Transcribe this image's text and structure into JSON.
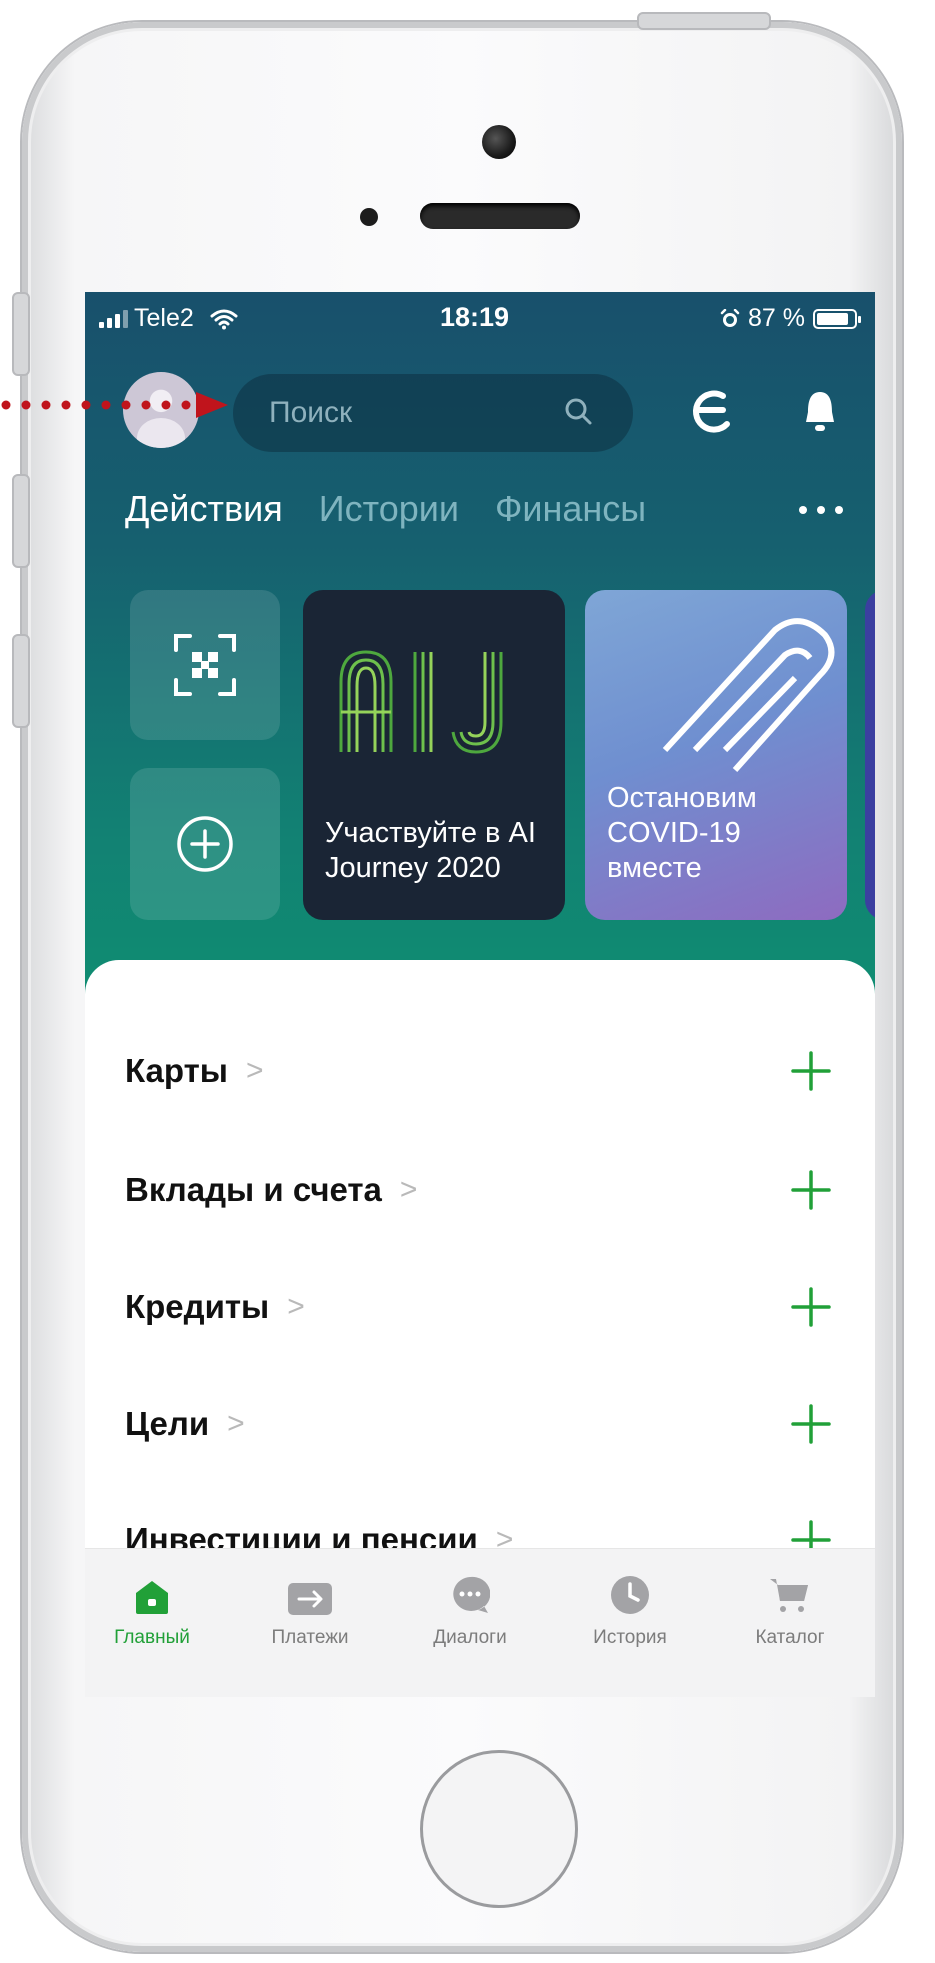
{
  "status_bar": {
    "carrier": "Tele2",
    "time": "18:19",
    "battery": "87 %",
    "battery_level": 0.87
  },
  "header": {
    "search_placeholder": "Поиск"
  },
  "tabs": [
    {
      "label": "Действия",
      "active": true
    },
    {
      "label": "Истории",
      "active": false
    },
    {
      "label": "Финансы",
      "active": false
    }
  ],
  "cards": [
    {
      "logo": "AIJ",
      "text": "Участвуйте в AI Journey 2020"
    },
    {
      "text": "Остановим COVID-19 вместе"
    }
  ],
  "sections": [
    {
      "label": "Карты"
    },
    {
      "label": "Вклады и счета"
    },
    {
      "label": "Кредиты"
    },
    {
      "label": "Цели"
    },
    {
      "label": "Инвестиции и пенсии"
    }
  ],
  "tabbar": [
    {
      "label": "Главный",
      "icon": "home-icon",
      "active": true
    },
    {
      "label": "Платежи",
      "icon": "payments-icon",
      "active": false
    },
    {
      "label": "Диалоги",
      "icon": "chat-icon",
      "active": false
    },
    {
      "label": "История",
      "icon": "clock-icon",
      "active": false
    },
    {
      "label": "Каталог",
      "icon": "cart-icon",
      "active": false
    }
  ],
  "colors": {
    "accent": "#21a038",
    "hero_top": "#18506c",
    "hero_bottom": "#0f8e72",
    "arrow": "#c0141c"
  }
}
